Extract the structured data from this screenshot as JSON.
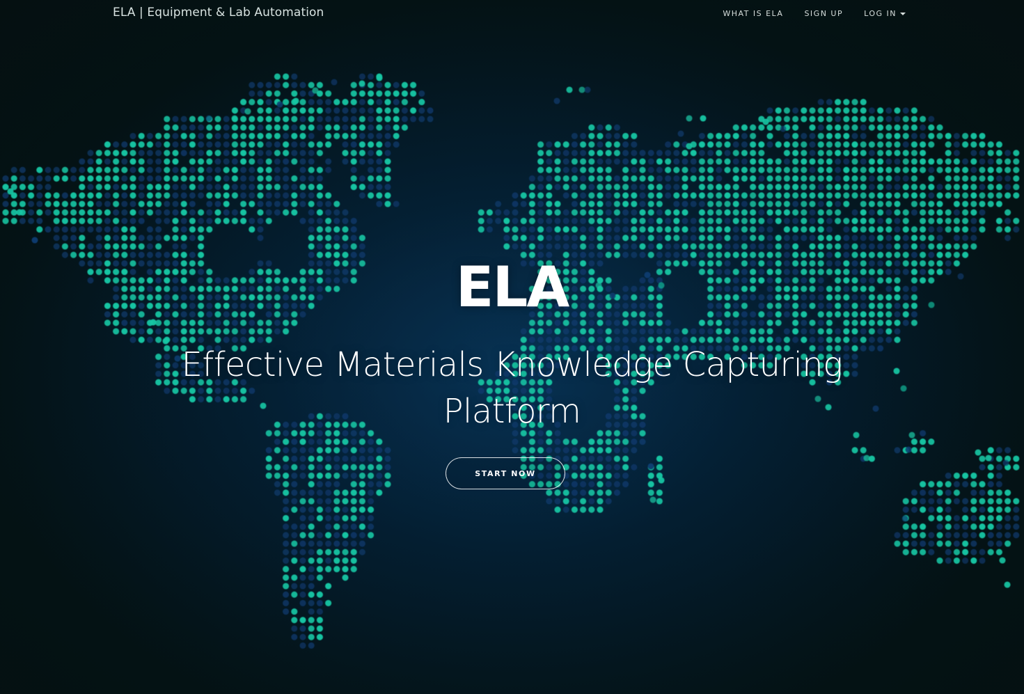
{
  "header": {
    "brand": "ELA | Equipment & Lab Automation",
    "nav": {
      "what_is": "WHAT IS ELA",
      "sign_up": "SIGN UP",
      "log_in": "LOG IN"
    }
  },
  "hero": {
    "title": "ELA",
    "subtitle": "Effective Materials Knowledge Capturing Platform",
    "cta": "START NOW"
  },
  "icons": {
    "log_in_menu": "chevron-down-icon",
    "map": "world-map-icon"
  },
  "colors": {
    "background": "#06110f",
    "map_teal": "#18c7a4",
    "map_blue": "#0b3c70",
    "text": "#ffffff"
  }
}
